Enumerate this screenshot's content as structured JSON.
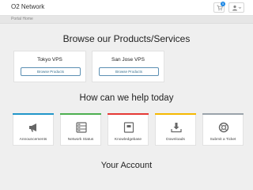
{
  "header": {
    "brand": "O2 Network",
    "cart_count": "0"
  },
  "breadcrumb": {
    "current": "Portal Home"
  },
  "products_section": {
    "title": "Browse our Products/Services",
    "items": [
      {
        "name": "Tokyo VPS",
        "button": "Browse Products"
      },
      {
        "name": "San Jose VPS",
        "button": "Browse Products"
      }
    ]
  },
  "help_section": {
    "title": "How can we help today",
    "items": [
      {
        "label": "Announcements",
        "icon": "megaphone-icon",
        "accent": "#2196c9"
      },
      {
        "label": "Network Status",
        "icon": "network-status-icon",
        "accent": "#4caf50"
      },
      {
        "label": "Knowledgebase",
        "icon": "book-icon",
        "accent": "#e53935"
      },
      {
        "label": "Downloads",
        "icon": "download-icon",
        "accent": "#f5b800"
      },
      {
        "label": "Submit a Ticket",
        "icon": "lifebuoy-icon",
        "accent": "#9aa3ab"
      }
    ]
  },
  "account_section": {
    "title": "Your Account"
  },
  "colors": {
    "background": "#efefef",
    "button_border": "#5b8fb3",
    "badge": "#1e88e5"
  }
}
